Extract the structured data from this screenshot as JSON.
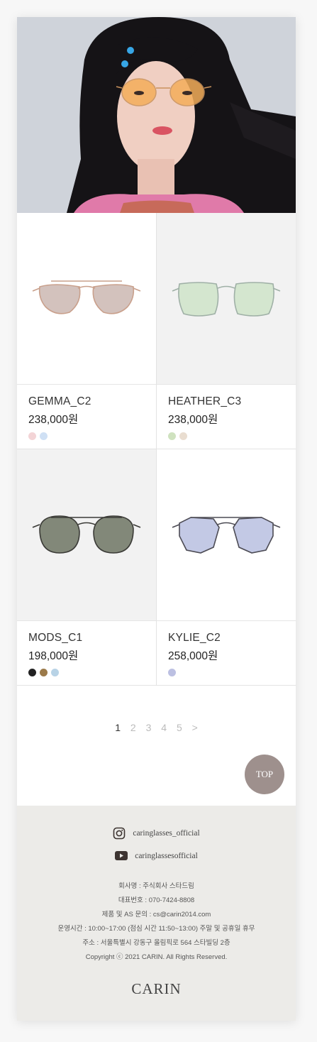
{
  "products": [
    {
      "name": "GEMMA_C2",
      "price": "238,000원",
      "bg": "white",
      "lens": "#cbb7b2",
      "frame": "#c9a08c",
      "swatches": [
        "#f3d4d6",
        "#cfe0f4"
      ]
    },
    {
      "name": "HEATHER_C3",
      "price": "238,000원",
      "bg": "gray",
      "lens": "#cfe4c9",
      "frame": "#9fb0a6",
      "swatches": [
        "#cfe2bf",
        "#e9ddd0"
      ]
    },
    {
      "name": "MODS_C1",
      "price": "198,000원",
      "bg": "gray",
      "lens": "#6e7664",
      "frame": "#3b3b37",
      "swatches": [
        "#222222",
        "#9b7a4a",
        "#b8d3e6"
      ]
    },
    {
      "name": "KYLIE_C2",
      "price": "258,000원",
      "bg": "white",
      "lens": "#b9bfe0",
      "frame": "#4c4b54",
      "swatches": [
        "#bcc0e2"
      ]
    }
  ],
  "pagination": {
    "pages": [
      "1",
      "2",
      "3",
      "4",
      "5"
    ],
    "next": ">",
    "current": "1"
  },
  "top_button": "TOP",
  "footer": {
    "instagram": "caringlasses_official",
    "youtube": "caringlassesofficial",
    "company": "회사명 : 주식회사 스타드림",
    "phone": "대표번호 : 070-7424-8808",
    "email": "제품 및 AS 문의 : cs@carin2014.com",
    "hours": "운영시간 : 10:00~17:00 (점심 시간 11:50~13:00) 주말 및 공휴일 휴무",
    "address": "주소 : 서울특별시 강동구 올림픽로 564 스타빌딩 2층",
    "copyright": "Copyright ⓒ 2021 CARIN. All Rights Reserved.",
    "logo": "CARIN"
  }
}
